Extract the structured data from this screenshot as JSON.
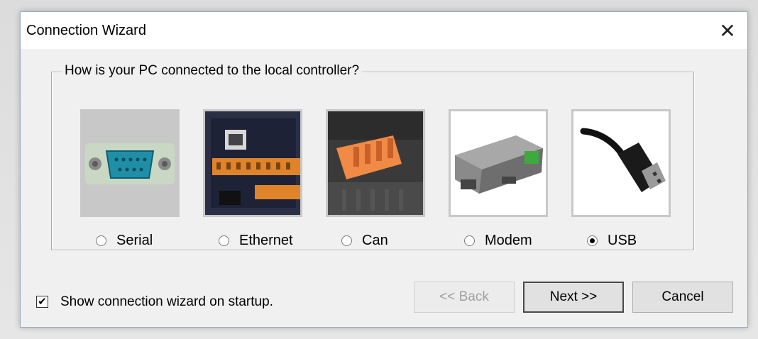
{
  "window": {
    "title": "Connection Wizard",
    "close_glyph": "✕"
  },
  "group": {
    "legend": "How is your PC connected to the local controller?"
  },
  "options": [
    {
      "label": "Serial",
      "icon": "serial-port-icon",
      "selected": false
    },
    {
      "label": "Ethernet",
      "icon": "ethernet-port-icon",
      "selected": false
    },
    {
      "label": "Can",
      "icon": "can-connector-icon",
      "selected": false
    },
    {
      "label": "Modem",
      "icon": "modem-icon",
      "selected": false
    },
    {
      "label": "USB",
      "icon": "usb-plug-icon",
      "selected": true
    }
  ],
  "startup": {
    "label": "Show connection wizard on startup.",
    "checked": true,
    "check_glyph": "✔"
  },
  "buttons": {
    "back": "<< Back",
    "next": "Next >>",
    "cancel": "Cancel"
  }
}
